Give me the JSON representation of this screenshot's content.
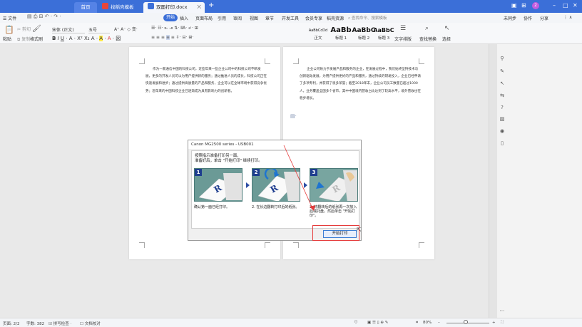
{
  "titlebar": {
    "tab_home": "首页",
    "tab_template": "找稻壳模板",
    "tab_document": "双面打印.docx",
    "window_badge": "2"
  },
  "menubar": {
    "file": "☰ 文件",
    "items": [
      "开始",
      "插入",
      "页面布局",
      "引用",
      "审阅",
      "视图",
      "章节",
      "开发工具",
      "会员专享",
      "稻壳资源"
    ],
    "search_placeholder": "查找命令、搜索模板",
    "right": [
      "未同步",
      "协作",
      "分享"
    ]
  },
  "ribbon": {
    "paste": "粘贴",
    "cut": "剪切",
    "copy": "复制",
    "format_painter": "格式刷",
    "font_name": "宋体 (正文)",
    "font_size": "五号",
    "styles": [
      {
        "sample": "AaBbCcDd",
        "name": "正文"
      },
      {
        "sample": "AaBb",
        "name": "标题 1"
      },
      {
        "sample": "AaBbC",
        "name": "标题 2"
      },
      {
        "sample": "AaBbC",
        "name": "标题 3"
      }
    ],
    "text_layout": "文字排版",
    "find_replace": "查找替换",
    "select": "选择"
  },
  "document": {
    "left_page_text": "作为一家通信中国的科技公司，近些年来一些企业公司中的科技公司不断发展，更多的开发人员可以为用户提供新的服务；通过推进人员的成长，科技公司正在快速发展和进步；通过提供高质量的产品和服务，企业可以在全球市场中获得竞争优势；近年来的中国科技企业已逐渐成为具有影响力的创新者。",
    "right_page_text": "企业公司致力于发展产品和服务的企业，在发展过程中，我们始终坚持技术与创新驱动发展，为用户提供更好的产品和服务，通过持续的研发投入，企业已经申请了多项专利，并获得了很多荣誉；截至2018年末，企业公司员工数量已超过1000人，业务覆盖全国多个省市，其中中国境内营收占比达到了较高水平，境外营收也在稳步增长。"
  },
  "dialog": {
    "title": "Canon MG2500 series - USB001",
    "message_line1": "按照指示准备打印另一面，",
    "message_line2": "准备好后，单击 \"开始打印\" 继续打印。",
    "steps": [
      {
        "num": "1",
        "caption": "确认第一面已经打印。"
      },
      {
        "num": "2",
        "caption": "2. 在长边翻转打印后的纸张。"
      },
      {
        "num": "3",
        "caption": "3. 将翻转后的纸张再一次放入后端托盘。然后单击 \"开始打印\"。"
      }
    ],
    "start_button": "开始打印"
  },
  "statusbar": {
    "page": "页面: 2/2",
    "word_count": "字数: 382",
    "spell_check": "拼写检查",
    "doc_check": "文档校对",
    "zoom": "80%"
  },
  "colors": {
    "titlebar": "#3b6fd8",
    "annotation": "#e53b3b"
  }
}
